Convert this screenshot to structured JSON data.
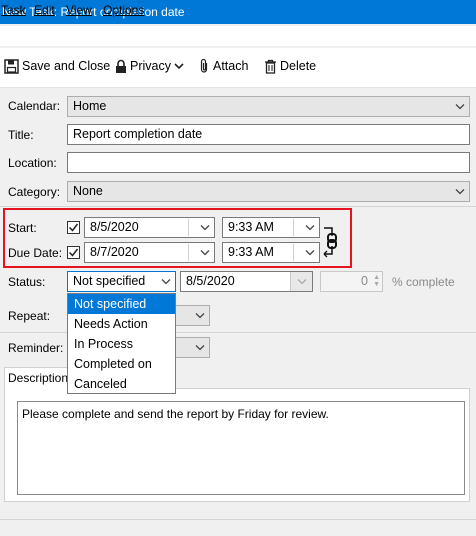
{
  "window": {
    "title": "New Task: Report completion date"
  },
  "menubar": {
    "items": [
      "Task",
      "Edit",
      "View",
      "Options"
    ]
  },
  "toolbar": {
    "save_close": "Save and Close",
    "privacy": "Privacy",
    "attach": "Attach",
    "delete": "Delete"
  },
  "form": {
    "calendar_label": "Calendar:",
    "calendar_value": "Home",
    "title_label": "Title:",
    "title_value": "Report completion date",
    "location_label": "Location:",
    "location_value": "",
    "category_label": "Category:",
    "category_value": "None",
    "start_label": "Start:",
    "start_date": "8/5/2020",
    "start_time": "9:33 AM",
    "due_label": "Due Date:",
    "due_date": "8/7/2020",
    "due_time": "9:33 AM",
    "status_label": "Status:",
    "status_value": "Not specified",
    "status_date": "8/5/2020",
    "percent_value": "0",
    "percent_label": "% complete",
    "repeat_label": "Repeat:",
    "reminder_label": "Reminder:"
  },
  "status_options": [
    "Not specified",
    "Needs Action",
    "In Process",
    "Completed on",
    "Canceled"
  ],
  "description": {
    "tab_label": "Description",
    "text": "Please complete and send the report by Friday for review."
  },
  "colors": {
    "titlebar": "#0078d7",
    "highlight": "#e4151f",
    "selection": "#0078d7"
  }
}
